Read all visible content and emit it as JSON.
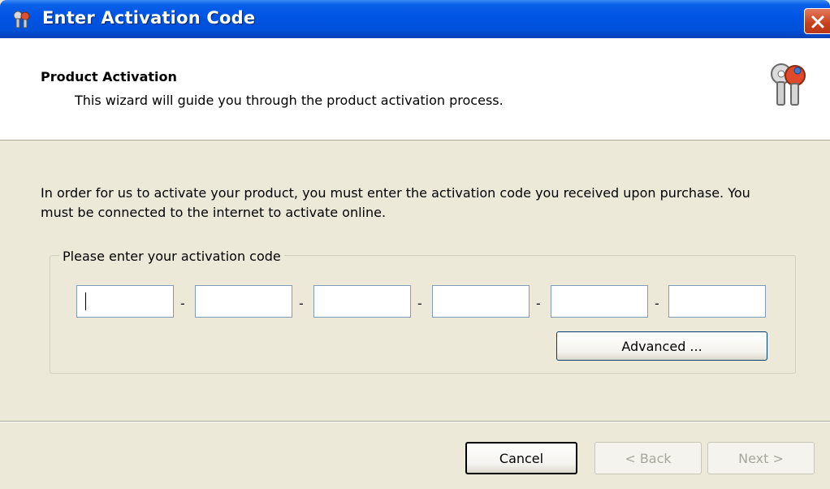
{
  "window": {
    "title": "Enter Activation Code",
    "close_icon": "close-icon"
  },
  "header": {
    "title": "Product Activation",
    "subtitle": "This wizard will guide you through the product activation process.",
    "icon": "keys-icon"
  },
  "content": {
    "instructions": "In order for us to activate your product, you must enter the activation code you received upon purchase. You must be connected to the internet to activate online.",
    "group_label": "Please enter your activation code",
    "code_fields": [
      "",
      "",
      "",
      "",
      "",
      ""
    ],
    "separator": "-",
    "advanced_label": "Advanced ..."
  },
  "footer": {
    "cancel_label": "Cancel",
    "back_label": "< Back",
    "next_label": "Next >"
  },
  "colors": {
    "titlebar": "#0054e3",
    "dialog_bg": "#ece9d8",
    "close_button": "#c8401c"
  }
}
